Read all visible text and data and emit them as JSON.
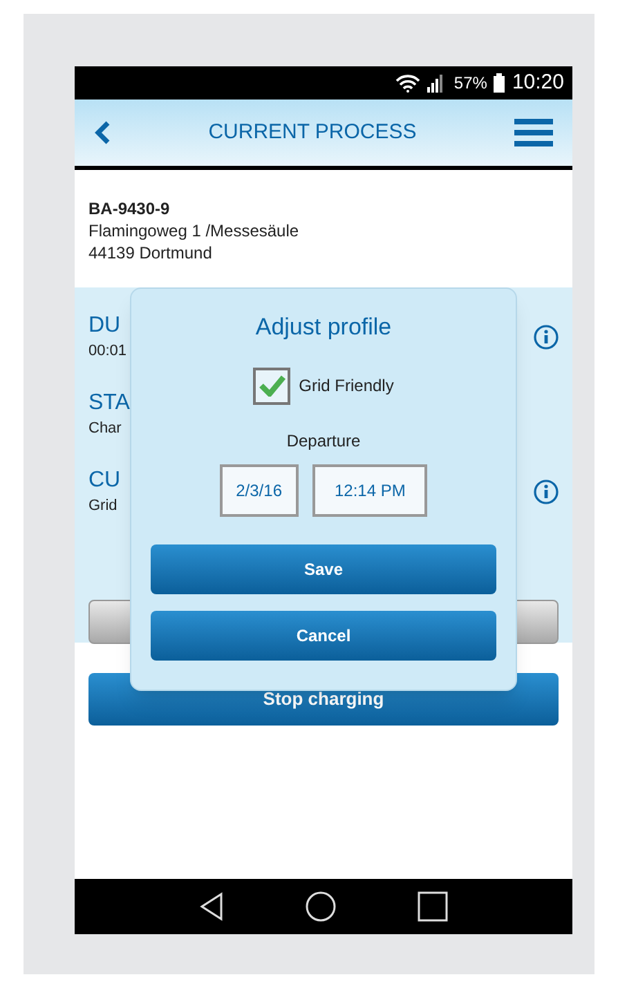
{
  "status_bar": {
    "battery": "57%",
    "time": "10:20"
  },
  "header": {
    "title": "CURRENT PROCESS"
  },
  "station": {
    "id": "BA-9430-9",
    "street": "Flamingoweg 1 /Messesäule",
    "city": "44139 Dortmund"
  },
  "details": [
    {
      "label": "DU",
      "value": "00:01",
      "info": true
    },
    {
      "label": "STA",
      "value": "Char",
      "info": false
    },
    {
      "label": "CU",
      "value": "Grid",
      "info": true
    }
  ],
  "stop_button": "Stop charging",
  "dialog": {
    "title": "Adjust profile",
    "grid_friendly": {
      "label": "Grid Friendly",
      "checked": true
    },
    "departure_label": "Departure",
    "date": "2/3/16",
    "time": "12:14 PM",
    "buttons": [
      "Save",
      "Cancel"
    ]
  }
}
